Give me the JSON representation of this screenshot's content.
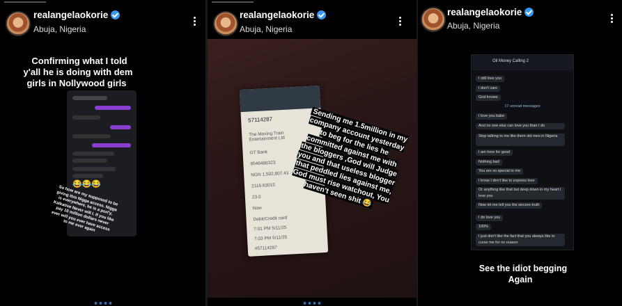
{
  "panels": [
    {
      "username": "realangelaokorie",
      "location": "Abuja, Nigeria",
      "caption": "Confirming what I told y'all he is doing with dem girls in Nollywood girls",
      "overlay_text": "So how are my supposed to be giving this Nigga access. Nigga is everywhere, he is a porl'y, Kalkative Never will I. If you like pay 10 million dollars never ever will you ever have access to me ever again",
      "emojis": "😂😂😂"
    },
    {
      "username": "realangelaokorie",
      "location": "Abuja, Nigeria",
      "caption": "Sending me 1.5million in my company account yesterday to beg for the lies he committed against me with the bloggers ,God will Judge you and that useless blogger that peddled lies against me, God must rise watchout, You haven't seen shit 😂",
      "receipt_lines": [
        "57114287",
        "The Moving Train Entertainment Ltd",
        "GT Bank",
        "9546488323",
        "NGN 1,502,807.43",
        "2116.63015",
        "23.0",
        "Now",
        "Debit/Credit card",
        "7:01 PM 5/11/25",
        "7:03 PM 5/11/25",
        "#57114287"
      ]
    },
    {
      "username": "realangelaokorie",
      "location": "Abuja, Nigeria",
      "chat_title": "Oil Money Calling 2",
      "unread_label": "17 unread messages",
      "messages": [
        "I still love you",
        "I don't care",
        "God knows",
        "I love you babe",
        "And no one else can love you than I do",
        "Stop talking to me like them old men in Nigeria",
        "I am here for good",
        "Nothing bad",
        "You are so special to me",
        "I know I don't like to express love",
        "Or anything like that but deep down in my heart I love you",
        "Now let me tell you the sincere truth",
        "I do love you",
        "100%",
        "I just don't like the fact that you always like to curse me for no reason"
      ],
      "caption": "See the idiot begging Again"
    }
  ]
}
